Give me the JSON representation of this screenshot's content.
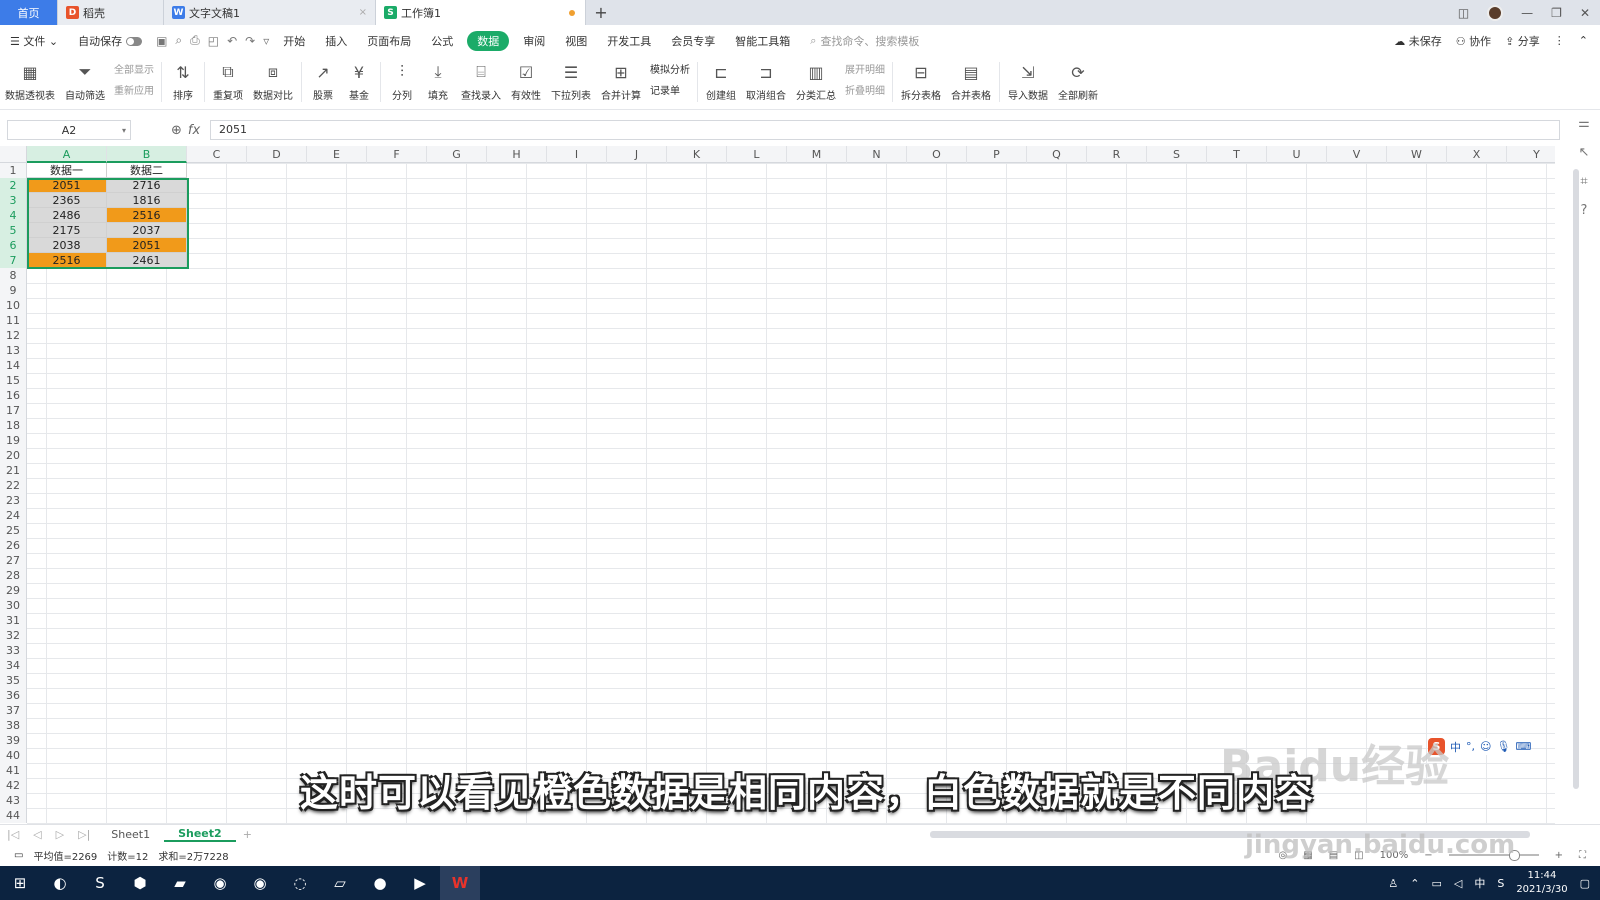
{
  "tabs": [
    {
      "label": "首页"
    },
    {
      "label": "稻壳",
      "icon": "D"
    },
    {
      "label": "文字文稿1",
      "icon": "W"
    },
    {
      "label": "工作簿1",
      "icon": "S"
    }
  ],
  "menu": {
    "file": "文件",
    "autosave": "自动保存",
    "items": [
      "开始",
      "插入",
      "页面布局",
      "公式",
      "数据",
      "审阅",
      "视图",
      "开发工具",
      "会员专享",
      "智能工具箱"
    ],
    "active": "数据",
    "search_placeholder": "查找命令、搜索模板",
    "unsaved": "未保存",
    "collab": "协作",
    "share": "分享"
  },
  "ribbon": {
    "pivot": "数据透视表",
    "autofilter": "自动筛选",
    "showall": "全部显示",
    "reapply": "重新应用",
    "sort": "排序",
    "dup": "重复项",
    "compare": "数据对比",
    "stock": "股票",
    "fund": "基金",
    "split": "分列",
    "fill": "填充",
    "lookup": "查找录入",
    "validity": "有效性",
    "dropdown": "下拉列表",
    "consolidate": "合并计算",
    "whatif": "模拟分析",
    "record": "记录单",
    "group": "创建组",
    "ungroup": "取消组合",
    "subtotal": "分类汇总",
    "expand": "展开明细",
    "collapse": "折叠明细",
    "splittable": "拆分表格",
    "mergetable": "合并表格",
    "import": "导入数据",
    "refresh": "全部刷新"
  },
  "formula": {
    "namebox": "A2",
    "value": "2051"
  },
  "columns": [
    "A",
    "B",
    "C",
    "D",
    "E",
    "F",
    "G",
    "H",
    "I",
    "J",
    "K",
    "L",
    "M",
    "N",
    "O",
    "P",
    "Q",
    "R",
    "S",
    "T",
    "U",
    "V",
    "W",
    "X",
    "Y"
  ],
  "rows": [
    "1",
    "2",
    "3",
    "4",
    "5",
    "6",
    "7",
    "8",
    "9",
    "10",
    "11",
    "12",
    "13",
    "14",
    "15",
    "16",
    "17",
    "18",
    "19",
    "20",
    "21",
    "22",
    "23",
    "24",
    "25",
    "26",
    "27",
    "28",
    "29",
    "30",
    "31",
    "32",
    "33",
    "34",
    "35",
    "36",
    "37",
    "38",
    "39",
    "40",
    "41",
    "42",
    "43",
    "44"
  ],
  "table": {
    "header": [
      "数据一",
      "数据二"
    ],
    "rows": [
      {
        "a": "2051",
        "b": "2716"
      },
      {
        "a": "2365",
        "b": "1816"
      },
      {
        "a": "2486",
        "b": "2516"
      },
      {
        "a": "2175",
        "b": "2037"
      },
      {
        "a": "2038",
        "b": "2051"
      },
      {
        "a": "2516",
        "b": "2461"
      }
    ]
  },
  "colors": {
    "highlight": "#f19a1a",
    "accent": "#1b9c5d",
    "plain": "#d9d9d9"
  },
  "sheets": [
    "Sheet1",
    "Sheet2"
  ],
  "active_sheet": "Sheet2",
  "status": {
    "avg": "平均值=2269",
    "count": "计数=12",
    "sum": "求和=2万7228",
    "zoom": "100%"
  },
  "taskbar": {
    "time": "11:44",
    "date": "2021/3/30",
    "ime": "中"
  },
  "subtitle": "这时可以看见橙色数据是相同内容，白色数据就是不同内容",
  "watermark": "Baidu经验",
  "watermark_url": "jingyan.baidu.com"
}
